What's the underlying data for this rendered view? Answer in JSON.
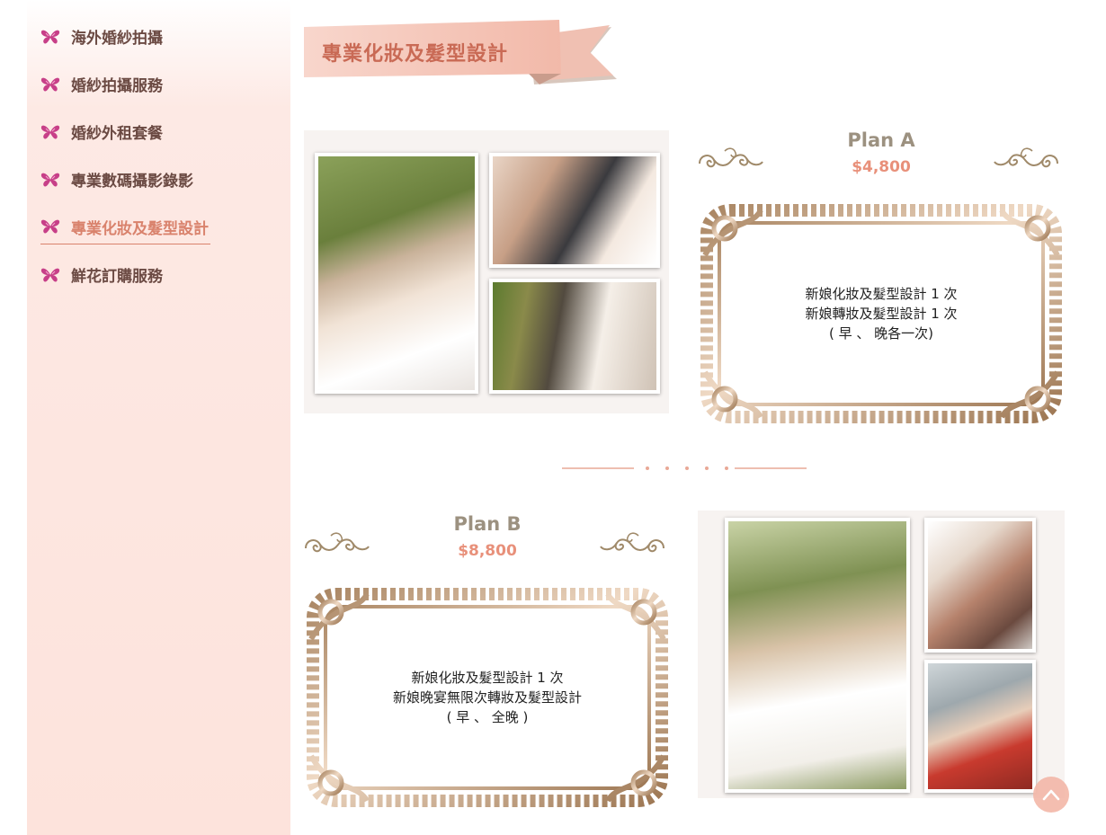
{
  "sidebar": {
    "items": [
      {
        "label": "海外婚紗拍攝",
        "active": false
      },
      {
        "label": "婚紗拍攝服務",
        "active": false
      },
      {
        "label": "婚紗外租套餐",
        "active": false
      },
      {
        "label": "專業數碼攝影錄影",
        "active": false
      },
      {
        "label": "專業化妝及髮型設計",
        "active": true
      },
      {
        "label": "鮮花訂購服務",
        "active": false
      }
    ],
    "icon": "butterfly-icon"
  },
  "page": {
    "title": "專業化妝及髮型設計"
  },
  "plans": [
    {
      "name": "Plan A",
      "price": "$4,800",
      "lines": [
        "新娘化妝及髮型設計 1 次",
        "新娘轉妝及髮型設計 1 次",
        "( 早 、 晚各一次)"
      ]
    },
    {
      "name": "Plan B",
      "price": "$8,800",
      "lines": [
        "新娘化妝及髮型設計 1 次",
        "新娘晚宴無限次轉妝及髮型設計",
        "( 早 、 全晚 )"
      ]
    }
  ],
  "colors": {
    "accent": "#d9826c",
    "price": "#e8907a",
    "plan_name": "#9c9180",
    "sidebar_text": "#6b4a43",
    "butterfly": "#c73f88",
    "frame_gold": "#b8916a"
  },
  "back_to_top_icon": "chevron-up-icon"
}
